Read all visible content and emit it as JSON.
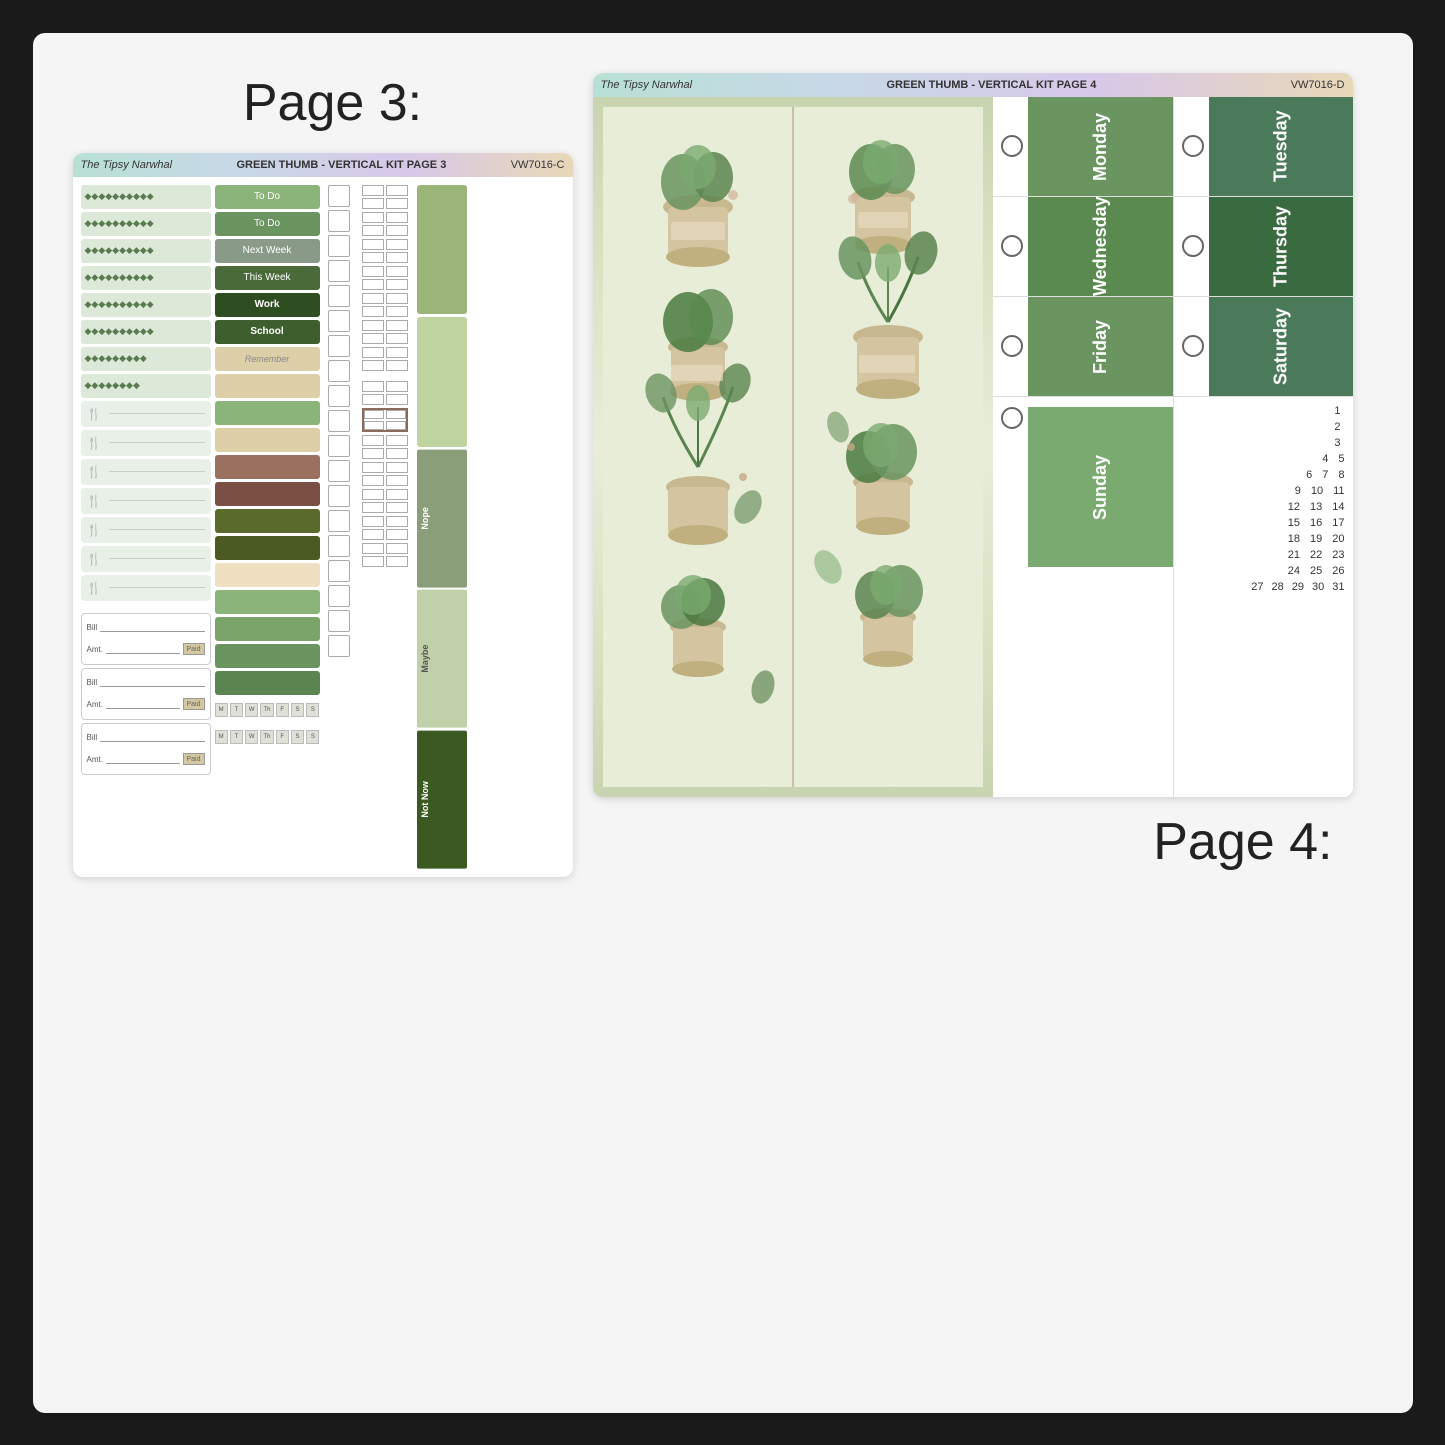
{
  "background": "#1a1a1a",
  "page3": {
    "title": "Page 3:",
    "header": {
      "brand": "The Tipsy Narwhal",
      "title": "GREEN THUMB - VERTICAL KIT PAGE 3",
      "code": "VW7016-C"
    },
    "labels": {
      "todo1": "To Do",
      "todo2": "To Do",
      "nextWeek": "Next Week",
      "thisWeek": "This Week",
      "work": "Work",
      "school": "School",
      "remember": "Remember"
    },
    "verticalStickers": {
      "nope": "Nope",
      "maybe": "Maybe",
      "notNow": "Not Now"
    },
    "habitDays": [
      "M",
      "T",
      "W",
      "Th",
      "F",
      "S",
      "S"
    ],
    "bill": {
      "label": "Bill",
      "amt": "Amt.",
      "paid": "Paid"
    }
  },
  "page4": {
    "title": "Page 4:",
    "header": {
      "brand": "The Tipsy Narwhal",
      "title": "GREEN THUMB - VERTICAL KIT PAGE 4",
      "code": "VW7016-D"
    },
    "days": [
      "Monday",
      "Tuesday",
      "Wednesday",
      "Thursday",
      "Friday",
      "Saturday",
      "Sunday"
    ],
    "calendar": {
      "numbers": [
        [
          "1"
        ],
        [
          "2"
        ],
        [
          "3"
        ],
        [
          "4",
          "5"
        ],
        [
          "6",
          "7",
          "8"
        ],
        [
          "9",
          "10",
          "11"
        ],
        [
          "12",
          "13",
          "14"
        ],
        [
          "15",
          "16",
          "17"
        ],
        [
          "18",
          "19",
          "20"
        ],
        [
          "21",
          "22",
          "23"
        ],
        [
          "24",
          "25",
          "26"
        ],
        [
          "27",
          "28",
          "29",
          "30",
          "31"
        ]
      ]
    }
  }
}
